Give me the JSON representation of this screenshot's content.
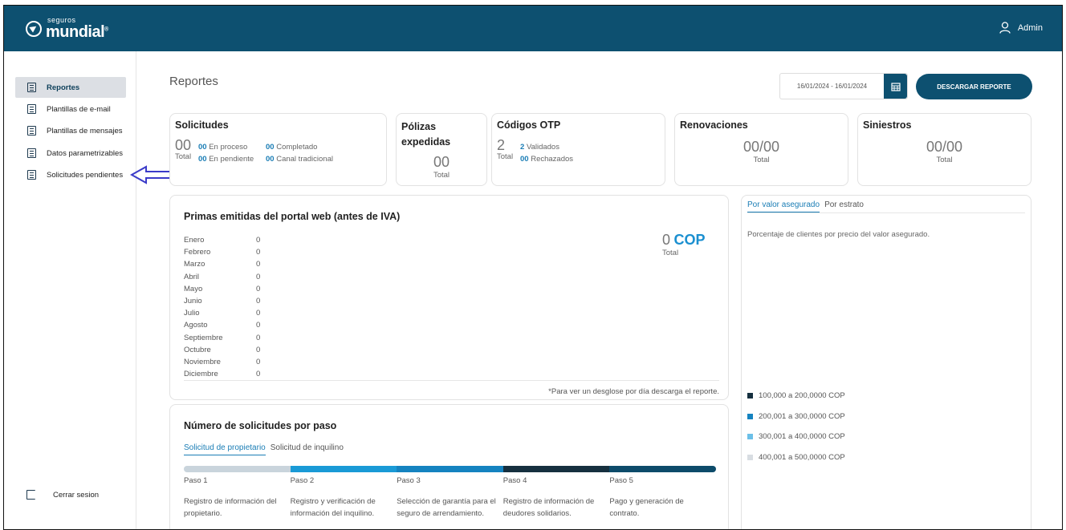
{
  "header": {
    "brand_small": "seguros",
    "brand_big": "mundial",
    "brand_mark": "®",
    "user": "Admin"
  },
  "sidebar": {
    "items": [
      {
        "label": "Reportes",
        "icon": "report-icon"
      },
      {
        "label": "Plantillas de e-mail",
        "icon": "email-template-icon"
      },
      {
        "label": "Plantillas de mensajes",
        "icon": "message-template-icon"
      },
      {
        "label": "Datos parametrizables",
        "icon": "settings-data-icon"
      },
      {
        "label": "Solicitudes pendientes",
        "icon": "download-icon"
      }
    ],
    "logout": "Cerrar sesion"
  },
  "page": {
    "title": "Reportes",
    "date_range": "16/01/2024 - 16/01/2024",
    "download_label": "DESCARGAR REPORTE"
  },
  "cards": {
    "solicitudes": {
      "title": "Solicitudes",
      "count": "00",
      "total": "Total",
      "proceso_n": "00",
      "proceso_l": "En proceso",
      "pendiente_n": "00",
      "pendiente_l": "En pendiente",
      "completado_n": "00",
      "completado_l": "Completado",
      "canal_n": "00",
      "canal_l": "Canal tradicional"
    },
    "polizas": {
      "title": "Pólizas expedidas",
      "count": "00",
      "total": "Total"
    },
    "otp": {
      "title": "Códigos OTP",
      "count": "2",
      "total": "Total",
      "validados_n": "2",
      "validados_l": "Validados",
      "rechazados_n": "00",
      "rechazados_l": "Rechazados"
    },
    "renovaciones": {
      "title": "Renovaciones",
      "count": "00/00",
      "total": "Total"
    },
    "siniestros": {
      "title": "Siniestros",
      "count": "00/00",
      "total": "Total"
    }
  },
  "primas": {
    "title": "Primas emitidas del portal web (antes de IVA)",
    "months": [
      {
        "name": "Enero",
        "value": "0"
      },
      {
        "name": "Febrero",
        "value": "0"
      },
      {
        "name": "Marzo",
        "value": "0"
      },
      {
        "name": "Abril",
        "value": "0"
      },
      {
        "name": "Mayo",
        "value": "0"
      },
      {
        "name": "Junio",
        "value": "0"
      },
      {
        "name": "Julio",
        "value": "0"
      },
      {
        "name": "Agosto",
        "value": "0"
      },
      {
        "name": "Septiembre",
        "value": "0"
      },
      {
        "name": "Octubre",
        "value": "0"
      },
      {
        "name": "Noviembre",
        "value": "0"
      },
      {
        "name": "Diciembre",
        "value": "0"
      }
    ],
    "total_value": "0",
    "currency": "COP",
    "total_label": "Total",
    "note": "*Para ver un desglose por día descarga el reporte."
  },
  "pasos": {
    "title": "Número de solicitudes por paso",
    "tabs": [
      "Solicitud de propietario",
      "Solicitud de inquilino"
    ],
    "steps": [
      {
        "name": "Paso 1",
        "desc": "Registro de información del propietario.",
        "color": "#c9d4dc"
      },
      {
        "name": "Paso 2",
        "desc": "Registro y verificación de información del inquilino.",
        "color": "#1a9ad6"
      },
      {
        "name": "Paso 3",
        "desc": "Selección de garantía para el seguro de arrendamiento.",
        "color": "#1583c0"
      },
      {
        "name": "Paso 4",
        "desc": "Registro de información de deudores solidarios.",
        "color": "#16303f"
      },
      {
        "name": "Paso 5",
        "desc": "Pago y generación de contrato.",
        "color": "#0d4b6a"
      }
    ]
  },
  "asegurado": {
    "tabs": [
      "Por valor asegurado",
      "Por estrato"
    ],
    "subtitle": "Porcentaje de clientes por precio del valor asegurado.",
    "legend": [
      {
        "label": "100,000 a 200,0000 COP",
        "color": "#16303f"
      },
      {
        "label": "200,001 a 300,0000 COP",
        "color": "#1583c0"
      },
      {
        "label": "300,001 a 400,0000 COP",
        "color": "#6cc0e8"
      },
      {
        "label": "400,001 a 500,0000 COP",
        "color": "#d8dde2"
      }
    ]
  }
}
